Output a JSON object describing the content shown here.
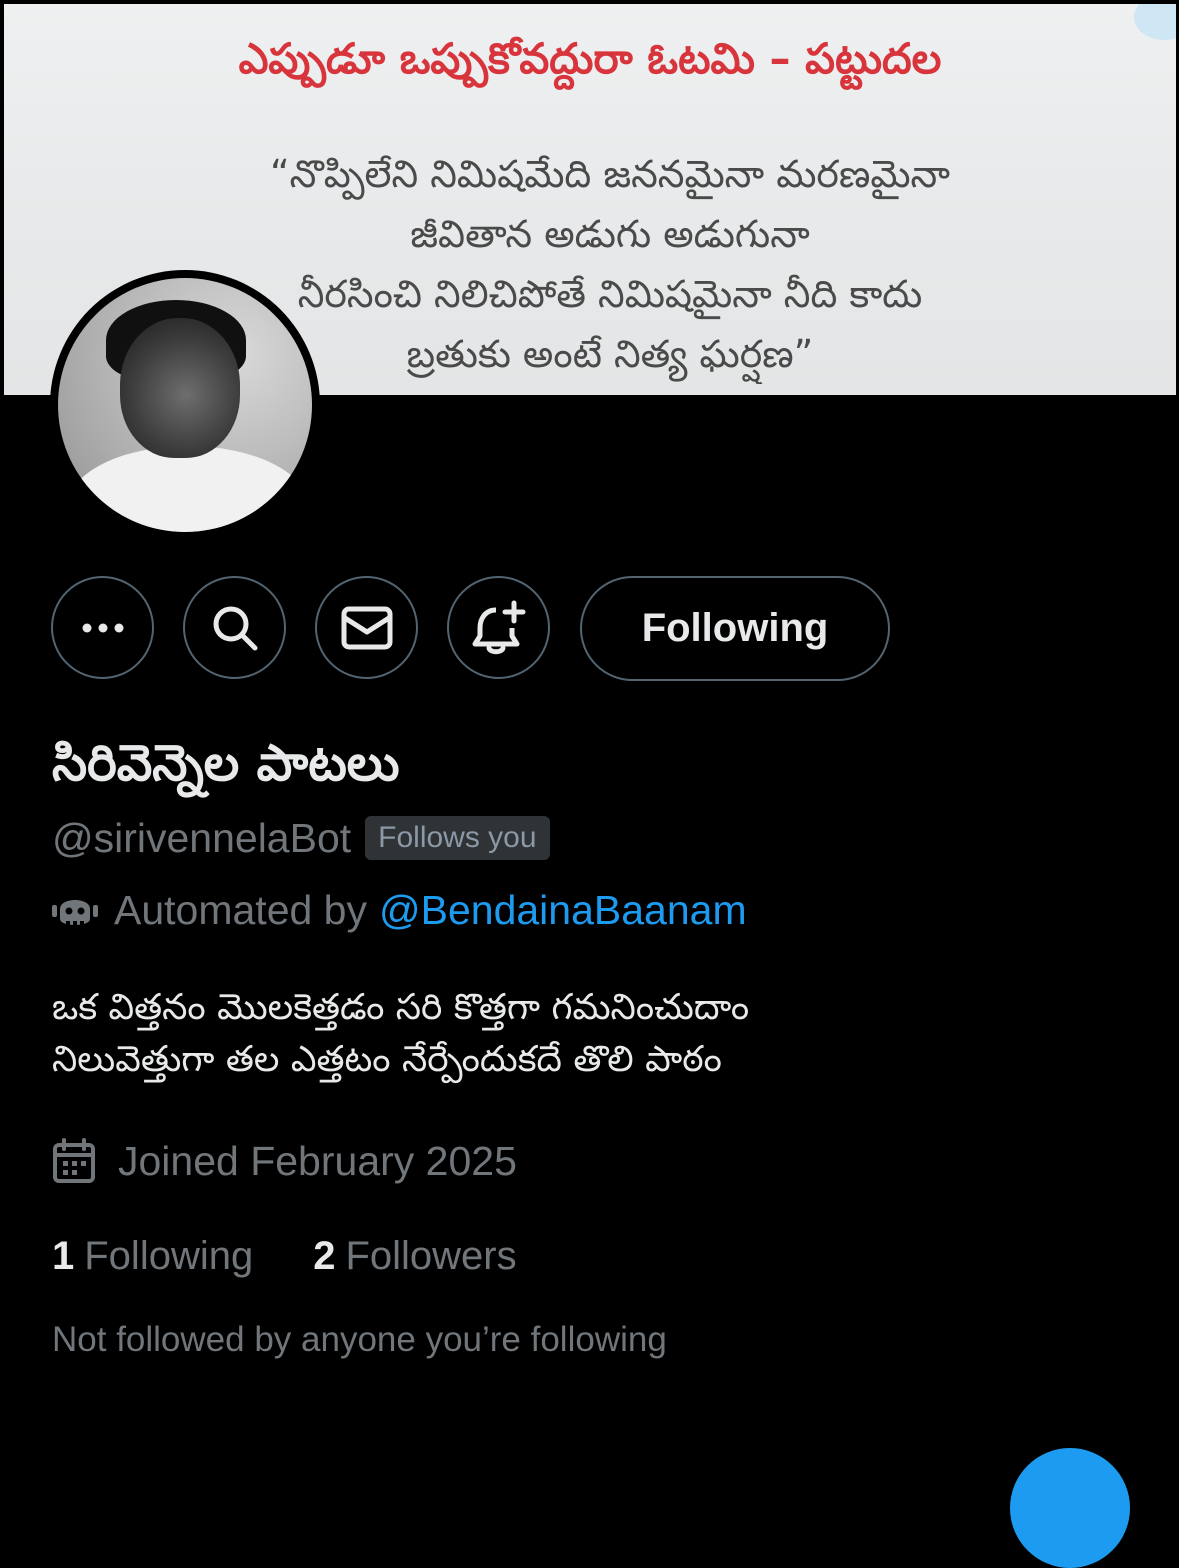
{
  "banner": {
    "title": "ఎప్పుడూ ఒప్పుకోవద్దురా ఓటమి – పట్టుదల",
    "quote_lines": [
      "“నొప్పిలేని నిమిషమేది జననమైనా మరణమైనా",
      "జీవితాన అడుగు అడుగునా",
      "నీరసించి నిలిచిపోతే నిమిషమైనా నీది కాదు",
      "బ్రతుకు అంటే నిత్య ఘర్షణ”"
    ]
  },
  "avatar": {
    "icon": "profile-photo"
  },
  "actions": {
    "more_icon": "more-icon",
    "search_icon": "search-icon",
    "message_icon": "mail-icon",
    "notify_icon": "bell-plus-icon",
    "following_label": "Following"
  },
  "profile": {
    "display_name": "సిరివెన్నెల పాటలు",
    "handle": "@sirivennelaBot",
    "follows_you": "Follows you",
    "automated_prefix": "Automated by",
    "automated_by": "@BendainaBaanam",
    "bio_lines": [
      "ఒక విత్తనం మొలకెత్తడం సరి కొత్తగా గమనించుదాం",
      "నిలువెత్తుగా తల ఎత్తటం నేర్పేందుకదే తొలి పాఠం"
    ],
    "joined": "Joined February 2025"
  },
  "stats": {
    "following_count": "1",
    "following_label": "Following",
    "followers_count": "2",
    "followers_label": "Followers"
  },
  "social_context": "Not followed by anyone you’re following",
  "colors": {
    "background": "#000000",
    "text_primary": "#e7e9ea",
    "text_secondary": "#71767b",
    "accent": "#1d9bf0",
    "border": "#536471",
    "banner_title": "#d8343c"
  }
}
